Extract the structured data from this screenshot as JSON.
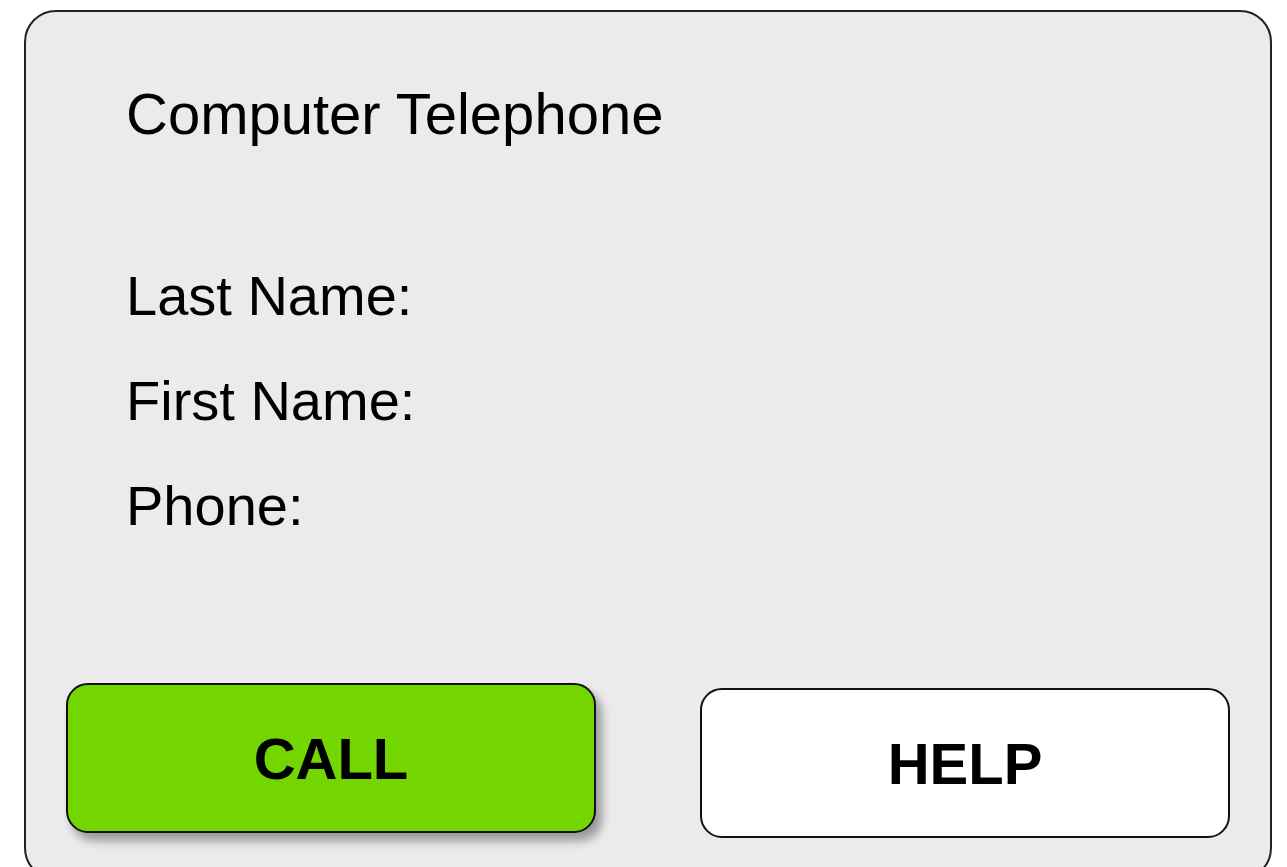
{
  "title": "Computer Telephone",
  "fields": [
    {
      "label": "Last Name:"
    },
    {
      "label": "First Name:"
    },
    {
      "label": "Phone:"
    }
  ],
  "buttons": [
    {
      "label": "CALL",
      "kind": "primary"
    },
    {
      "label": "HELP",
      "kind": "secondary"
    }
  ]
}
